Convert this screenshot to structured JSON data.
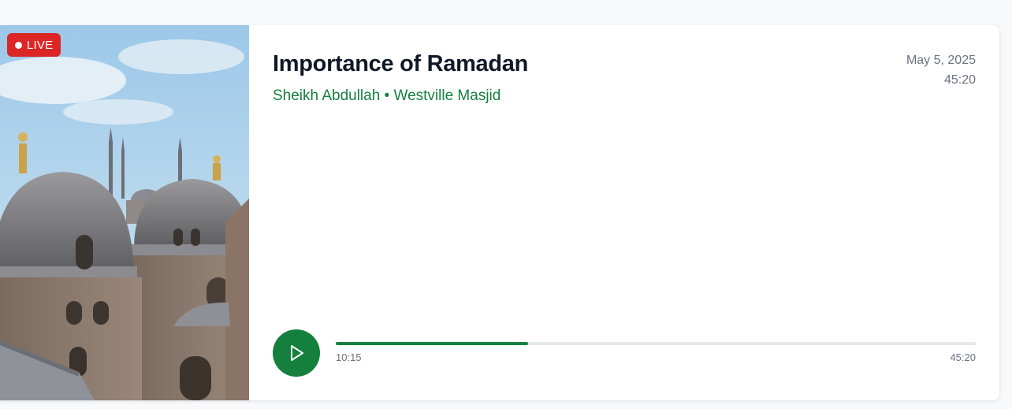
{
  "card": {
    "badge": {
      "label": "LIVE",
      "color": "#dc2626"
    },
    "thumbnail": {
      "subject": "mosque domes and minarets under blue sky"
    },
    "title": "Importance of Ramadan",
    "subtitle": "Sheikh Abdullah • Westville Masjid",
    "date": "May 5, 2025",
    "duration": "45:20",
    "accent_color": "#15803d"
  },
  "player": {
    "play_icon": "play-icon",
    "current_time": "10:15",
    "total_time": "45:20",
    "progress": 0.3
  }
}
